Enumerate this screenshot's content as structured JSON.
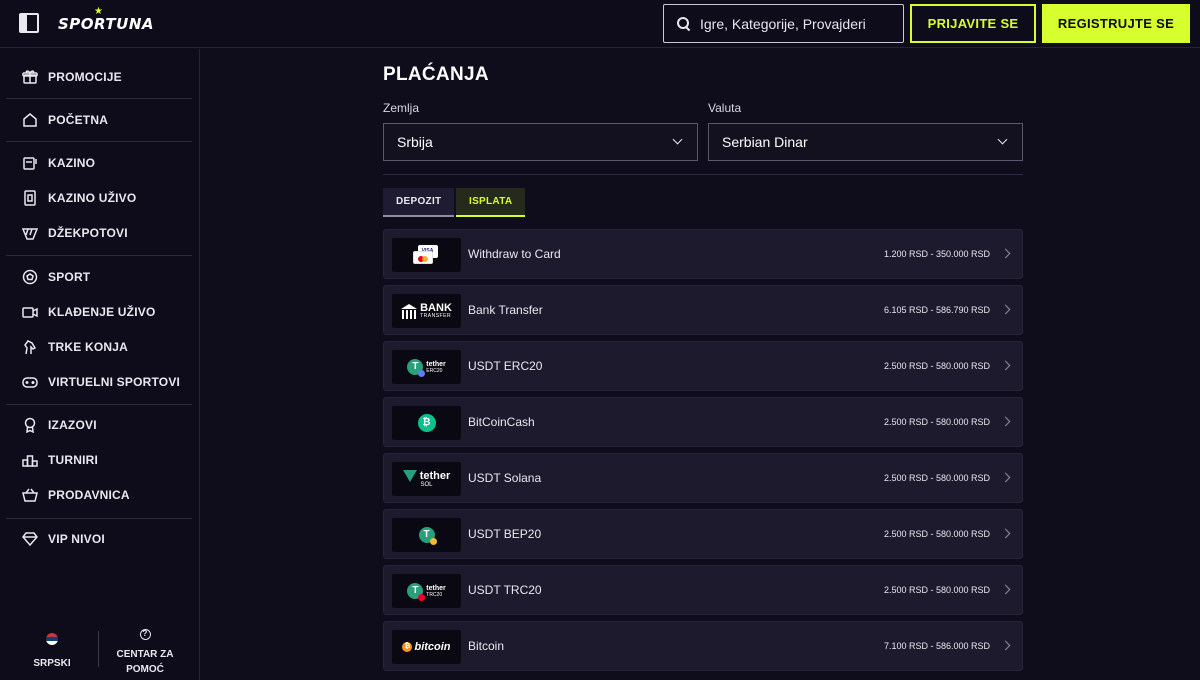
{
  "header": {
    "logo_text": "SPORTUNA",
    "search_placeholder": "Igre, Kategorije, Provajderi",
    "login_label": "PRIJAVITE SE",
    "register_label": "REGISTRUJTE SE",
    "accent_color": "#d6ff2d"
  },
  "sidebar": {
    "items": [
      {
        "label": "PROMOCIJE",
        "icon": "gift-icon"
      },
      {
        "label": "POČETNA",
        "icon": "home-icon"
      },
      {
        "label": "KAZINO",
        "icon": "slot-machine-icon"
      },
      {
        "label": "KAZINO UŽIVO",
        "icon": "live-casino-icon"
      },
      {
        "label": "DŽEKPOTOVI",
        "icon": "jackpot-icon"
      },
      {
        "label": "SPORT",
        "icon": "soccer-ball-icon"
      },
      {
        "label": "KLAĐENJE UŽIVO",
        "icon": "video-camera-icon"
      },
      {
        "label": "TRKE KONJA",
        "icon": "horse-icon"
      },
      {
        "label": "VIRTUELNI SPORTOVI",
        "icon": "gamepad-icon"
      },
      {
        "label": "IZAZOVI",
        "icon": "medal-icon"
      },
      {
        "label": "TURNIRI",
        "icon": "podium-icon"
      },
      {
        "label": "PRODAVNICA",
        "icon": "shopping-basket-icon"
      },
      {
        "label": "VIP NIVOI",
        "icon": "diamond-icon"
      }
    ],
    "footer": {
      "language_label": "SRPSKI",
      "help_label_line1": "CENTAR ZA",
      "help_label_line2": "POMOĆ"
    }
  },
  "main": {
    "title": "PLAĆANJA",
    "country_label": "Zemlja",
    "country_value": "Srbija",
    "currency_label": "Valuta",
    "currency_value": "Serbian Dinar",
    "tabs": [
      {
        "label": "DEPOZIT",
        "active": false
      },
      {
        "label": "ISPLATA",
        "active": true
      }
    ],
    "methods": [
      {
        "name": "Withdraw to Card",
        "range": "1.200 RSD - 350.000 RSD",
        "logo": "card-logo",
        "logo_text": "VISA"
      },
      {
        "name": "Bank Transfer",
        "range": "6.105 RSD - 586.790 RSD",
        "logo": "bank-logo",
        "logo_text": "BANK",
        "logo_sub": "TRANSFER"
      },
      {
        "name": "USDT ERC20",
        "range": "2.500 RSD - 580.000 RSD",
        "logo": "tether-logo",
        "logo_text": "tether",
        "logo_sub": "ERC20",
        "dot_color": "#627eea"
      },
      {
        "name": "BitCoinCash",
        "range": "2.500 RSD - 580.000 RSD",
        "logo": "bch-logo"
      },
      {
        "name": "USDT Solana",
        "range": "2.500 RSD - 580.000 RSD",
        "logo": "tether-sol-logo",
        "logo_text": "tether",
        "logo_sub": "SOL"
      },
      {
        "name": "USDT BEP20",
        "range": "2.500 RSD - 580.000 RSD",
        "logo": "tether-bep-logo",
        "dot_color": "#f3ba2f"
      },
      {
        "name": "USDT TRC20",
        "range": "2.500 RSD - 580.000 RSD",
        "logo": "tether-logo",
        "logo_text": "tether",
        "logo_sub": "TRC20",
        "dot_color": "#ef0027"
      },
      {
        "name": "Bitcoin",
        "range": "7.100 RSD - 586.000 RSD",
        "logo": "bitcoin-logo",
        "logo_text": "bitcoin"
      }
    ]
  }
}
